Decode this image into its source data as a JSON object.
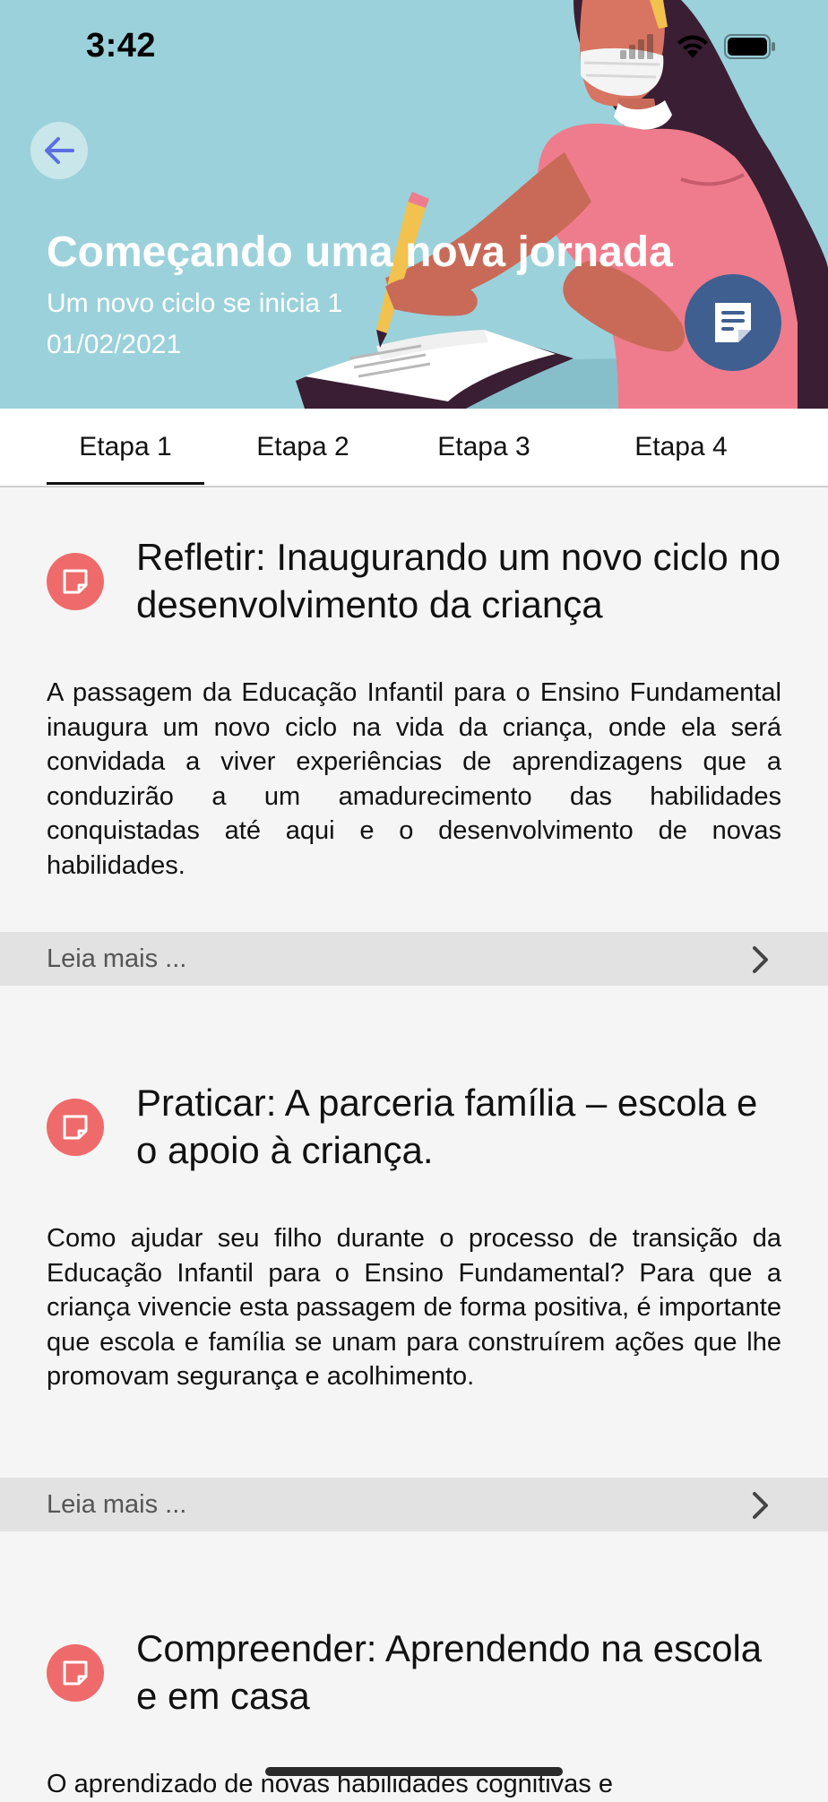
{
  "status_bar": {
    "time": "3:42"
  },
  "header": {
    "title": "Começando uma nova jornada",
    "subtitle": "Um novo ciclo se inicia 1",
    "date": "01/02/2021",
    "icons": {
      "back": "arrow-left-icon",
      "notes": "notes-icon"
    },
    "colors": {
      "background": "#9bd1da",
      "fab": "#3f5f90",
      "back_button": "#c9e6ea"
    }
  },
  "tabs": [
    {
      "label": "Etapa 1",
      "selected": true
    },
    {
      "label": "Etapa 2",
      "selected": false
    },
    {
      "label": "Etapa 3",
      "selected": false
    },
    {
      "label": "Etapa 4",
      "selected": false
    }
  ],
  "cards": [
    {
      "icon": "note-icon",
      "title": "Refletir: Inaugurando um novo ciclo no desenvolvimento da criança",
      "body": "A passagem da Educação Infantil para o Ensino Fundamental inaugura um novo ciclo na vida da criança, onde ela será convidada a viver experiências de aprendizagens que a conduzirão a um amadurecimento das habilidades conquistadas até aqui e o desenvolvimento de novas habilidades.",
      "read_more": "Leia mais ..."
    },
    {
      "icon": "note-icon",
      "title": "Praticar: A parceria família – escola e o apoio à criança.",
      "body": "Como ajudar seu filho durante o processo de transição da Educação Infantil para o Ensino Fundamental? Para que a criança vivencie esta passagem de forma positiva, é importante que escola e família se unam para construírem ações que lhe promovam segurança e acolhimento.",
      "read_more": "Leia mais ..."
    },
    {
      "icon": "note-icon",
      "title": "Compreender: Aprendendo na escola e em casa",
      "body": "O aprendizado de novas habilidades cognitivas e"
    }
  ],
  "colors": {
    "accent_icon": "#ef6b6b",
    "page_background": "#f5f5f5",
    "read_more_bar": "#e2e2e2"
  }
}
